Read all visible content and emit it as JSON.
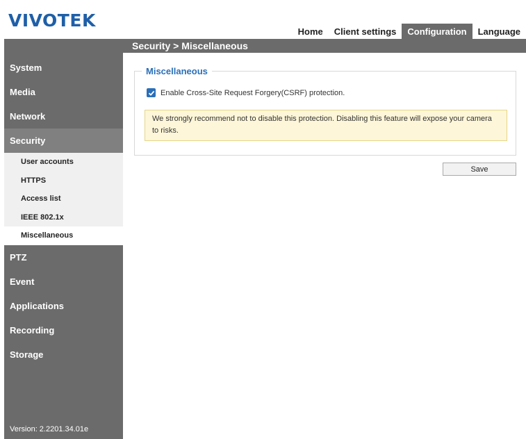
{
  "brand": {
    "logo_text": "VIVOTEK"
  },
  "topnav": {
    "items": [
      {
        "label": "Home",
        "active": false
      },
      {
        "label": "Client settings",
        "active": false
      },
      {
        "label": "Configuration",
        "active": true
      },
      {
        "label": "Language",
        "active": false
      }
    ]
  },
  "breadcrumb": {
    "section": "Security",
    "separator": " > ",
    "page": "Miscellaneous"
  },
  "sidebar": {
    "items": [
      {
        "label": "System"
      },
      {
        "label": "Media"
      },
      {
        "label": "Network"
      },
      {
        "label": "Security"
      },
      {
        "label": "PTZ"
      },
      {
        "label": "Event"
      },
      {
        "label": "Applications"
      },
      {
        "label": "Recording"
      },
      {
        "label": "Storage"
      }
    ],
    "security_subitems": [
      {
        "label": "User accounts"
      },
      {
        "label": "HTTPS"
      },
      {
        "label": "Access list"
      },
      {
        "label": "IEEE 802.1x"
      },
      {
        "label": "Miscellaneous"
      }
    ],
    "version": "Version: 2.2201.34.01e"
  },
  "panel": {
    "legend": "Miscellaneous",
    "csrf_checkbox": {
      "checked": true,
      "label": "Enable Cross-Site Request Forgery(CSRF) protection."
    },
    "warning": "We strongly recommend not to disable this protection. Disabling this feature will expose your camera to risks."
  },
  "actions": {
    "save_label": "Save"
  },
  "colors": {
    "accent": "#2a6fb8",
    "nav_gray": "#6b6b6b",
    "warning_bg": "#fdf6d8",
    "logo": "#1f5fa8"
  }
}
